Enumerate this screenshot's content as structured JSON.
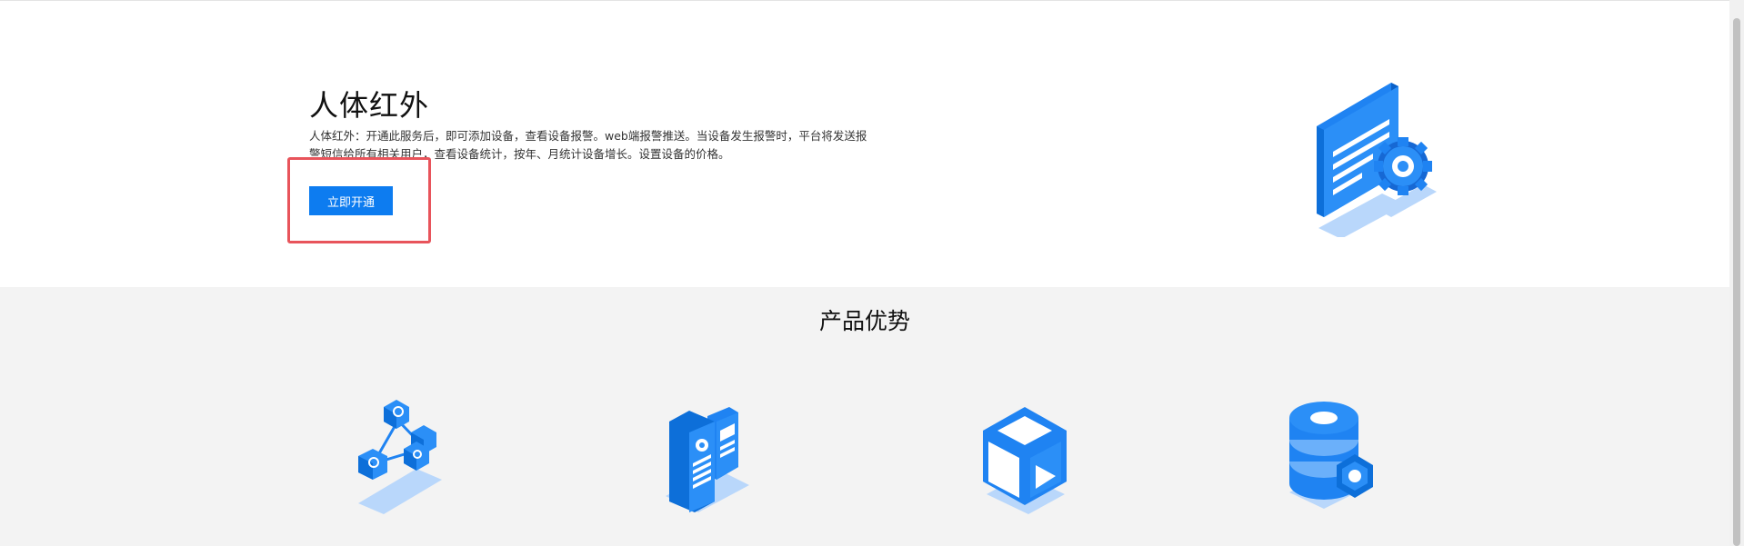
{
  "hero": {
    "title": "人体红外",
    "description": "人体红外：开通此服务后，即可添加设备，查看设备报警。web端报警推送。当设备发生报警时，平台将发送报警短信给所有相关用户，查看设备统计，按年、月统计设备增长。设置设备的价格。",
    "button_label": "立即开通",
    "illustration_icon": "document-gear-icon"
  },
  "advantages": {
    "title": "产品优势",
    "items": [
      {
        "icon": "network-cubes-icon"
      },
      {
        "icon": "server-documents-icon"
      },
      {
        "icon": "cube-play-icon"
      },
      {
        "icon": "database-gear-icon"
      }
    ]
  },
  "colors": {
    "accent": "#0d7cf0",
    "highlight": "#e8545b",
    "section_bg": "#f3f3f3"
  }
}
